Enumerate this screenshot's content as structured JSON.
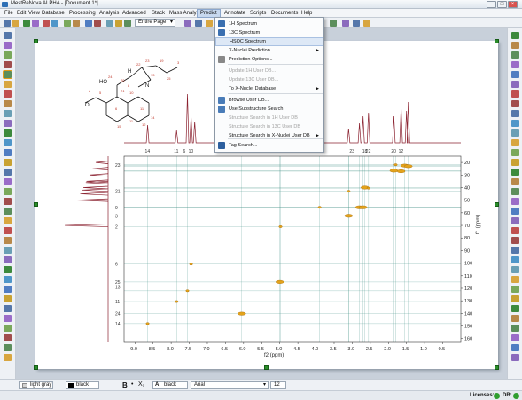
{
  "window": {
    "title": "MestReNova ALPHA - [Document 1*]"
  },
  "menubar": {
    "items": [
      "File",
      "Edit",
      "View",
      "Database",
      "Processing",
      "Analysis",
      "Advanced",
      "Stack",
      "Mass Analysis",
      "Predict",
      "Annotate",
      "Scripts",
      "Documents",
      "Help"
    ],
    "active": "Predict"
  },
  "toolbar": {
    "page_select": "Entire Page"
  },
  "predict_menu": {
    "items": [
      {
        "label": "1H Spectrum",
        "enabled": true,
        "icon": "h-spectrum-icon"
      },
      {
        "label": "13C Spectrum",
        "enabled": true,
        "icon": "c-spectrum-icon"
      },
      {
        "label": "HSQC Spectrum",
        "enabled": true,
        "highlighted": true
      },
      {
        "label": "X-Nuclei Prediction",
        "enabled": true,
        "submenu": true
      },
      {
        "label": "Prediction Options...",
        "enabled": true,
        "icon": "options-icon"
      },
      {
        "label": "Update 1H User DB...",
        "enabled": false
      },
      {
        "label": "Update 13C User DB...",
        "enabled": false
      },
      {
        "label": "To X-Nuclei Database",
        "enabled": true,
        "submenu": true
      },
      {
        "label": "Browse User DB...",
        "enabled": true,
        "icon": "db-icon"
      },
      {
        "label": "Use Substructure Search",
        "enabled": true,
        "icon": "check-icon"
      },
      {
        "label": "Structure Search in 1H User DB",
        "enabled": false
      },
      {
        "label": "Structure Search in 13C User DB",
        "enabled": false
      },
      {
        "label": "Structure Search in X-Nuclei User DB",
        "enabled": true,
        "submenu": true
      },
      {
        "label": "Tag Search...",
        "enabled": true,
        "icon": "tag-icon"
      }
    ]
  },
  "molecule": {
    "labels": [
      "HO",
      "N",
      "H",
      "O"
    ],
    "atom_numbers": [
      "24",
      "20",
      "22",
      "23",
      "19",
      "10",
      "21",
      "25",
      "3",
      "13",
      "8",
      "5",
      "15",
      "2",
      "12",
      "6",
      "11",
      "11",
      "14"
    ]
  },
  "spectrum": {
    "f2_label": "f2 (ppm)",
    "f1_label": "f1 (ppm)",
    "f2_ticks": [
      "9.0",
      "8.5",
      "8.0",
      "7.5",
      "7.0",
      "6.5",
      "6.0",
      "5.5",
      "5.0",
      "4.5",
      "4.0",
      "3.5",
      "3.0",
      "2.5",
      "2.0",
      "1.5",
      "1.0",
      "0.5"
    ],
    "f1_ticks": [
      "20",
      "30",
      "40",
      "50",
      "60",
      "70",
      "80",
      "90",
      "100",
      "110",
      "120",
      "130",
      "140",
      "150",
      "160"
    ],
    "top_trace_labels": [
      "14",
      "11",
      "6",
      "10",
      "23",
      "18",
      "22",
      "20",
      "12"
    ],
    "left_trace_labels": [
      "23",
      "21",
      "9",
      "3",
      "2",
      "6",
      "25",
      "13",
      "11",
      "24",
      "14"
    ]
  },
  "chart_data": {
    "type": "scatter",
    "title": "",
    "xlabel": "f2 (ppm)",
    "ylabel": "f1 (ppm)",
    "xlim": [
      9.3,
      0.0
    ],
    "ylim": [
      15,
      163
    ],
    "grid": true,
    "series": [
      {
        "values": [
          [
            8.65,
            148.1
          ],
          [
            7.85,
            130.6
          ],
          [
            7.55,
            122.0
          ],
          [
            7.45,
            100.8
          ],
          [
            6.05,
            140.2
          ],
          [
            5.0,
            115.0
          ],
          [
            4.98,
            71.0
          ],
          [
            3.9,
            55.7
          ],
          [
            3.1,
            62.4
          ],
          [
            3.1,
            43.0
          ],
          [
            2.8,
            55.7
          ],
          [
            2.7,
            55.7
          ],
          [
            2.65,
            40.0
          ],
          [
            2.55,
            40.5
          ],
          [
            1.85,
            26.5
          ],
          [
            1.8,
            21.8
          ],
          [
            1.65,
            27.0
          ],
          [
            1.55,
            22.5
          ],
          [
            1.45,
            23.0
          ]
        ]
      }
    ]
  },
  "format_bar": {
    "fill_color": "light gray",
    "line_color": "black",
    "text_color": "black",
    "font": "Arial",
    "font_size": "12"
  },
  "status": {
    "licenses_label": "Licenses:",
    "db_label": "DB:"
  },
  "colors": {
    "trace": "#8b2230",
    "cross_peak": "#e3a31b",
    "grid": "#3f8f84",
    "handle": "#2a8c2a"
  }
}
